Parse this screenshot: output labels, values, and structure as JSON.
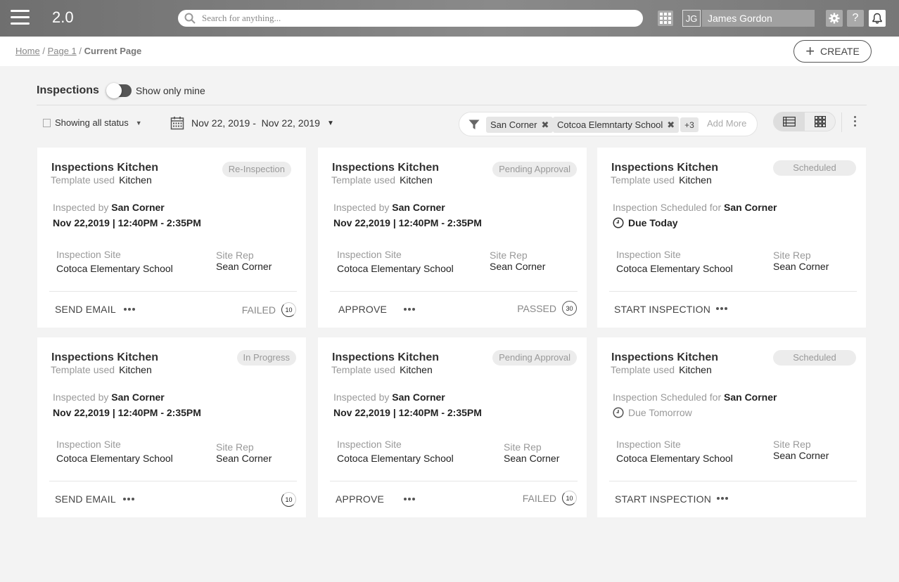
{
  "app": {
    "version": "2.0"
  },
  "search": {
    "placeholder": "Search for anything..."
  },
  "user": {
    "initials": "JG",
    "name": "James Gordon"
  },
  "topbar_icons": [
    "apps-grid-icon",
    "gear-icon",
    "help-icon",
    "bell-icon"
  ],
  "breadcrumb": {
    "home": "Home",
    "page1": "Page 1",
    "current": "Current Page",
    "sep": "/"
  },
  "create_label": "CREATE",
  "page_title": "Inspections",
  "toggle_label": "Show only mine",
  "status_filter": "Showing all status",
  "date_range": {
    "from": "Nov 22, 2019",
    "to": "Nov 22, 2019",
    "sep": "-"
  },
  "filters": {
    "chips": [
      "San Corner",
      "Cotcoa Elemntarty School"
    ],
    "more": "+3",
    "add_more": "Add More"
  },
  "cards": [
    {
      "title": "Inspections Kitchen",
      "template_label": "Template used",
      "template": "Kitchen",
      "status": "Re-Inspection",
      "by_label": "Inspected by",
      "by": "San Corner",
      "when": "Nov 22,2019 | 12:40PM - 2:35PM",
      "site_label": "Inspection Site",
      "site": "Cotoca Elementary School",
      "rep_label": "Site Rep",
      "rep": "Sean Corner",
      "action": "SEND EMAIL",
      "result": "FAILED",
      "score": "10"
    },
    {
      "title": "Inspections Kitchen",
      "template_label": "Template used",
      "template": "Kitchen",
      "status": "Pending Approval",
      "by_label": "Inspected by",
      "by": "San Corner",
      "when": "Nov 22,2019 | 12:40PM - 2:35PM",
      "site_label": "Inspection Site",
      "site": "Cotoca Elementary School",
      "rep_label": "Site Rep",
      "rep": "Sean Corner",
      "action": "APPROVE",
      "result": "PASSED",
      "score": "30"
    },
    {
      "title": "Inspections Kitchen",
      "template_label": "Template used",
      "template": "Kitchen",
      "status": "Scheduled",
      "by_label": "Inspection Scheduled for",
      "by": "San Corner",
      "when": "Due Today",
      "site_label": "Inspection Site",
      "site": "Cotoca Elementary School",
      "rep_label": "Site Rep",
      "rep": "Sean Corner",
      "action": "START INSPECTION"
    },
    {
      "title": "Inspections Kitchen",
      "template_label": "Template used",
      "template": "Kitchen",
      "status": "In Progress",
      "by_label": "Inspected by",
      "by": "San Corner",
      "when": "Nov 22,2019 | 12:40PM - 2:35PM",
      "site_label": "Inspection Site",
      "site": "Cotoca Elementary School",
      "rep_label": "Site Rep",
      "rep": "Sean Corner",
      "action": "SEND EMAIL",
      "score": "10"
    },
    {
      "title": "Inspections Kitchen",
      "template_label": "Template used",
      "template": "Kitchen",
      "status": "Pending Approval",
      "by_label": "Inspected by",
      "by": "San Corner",
      "when": "Nov 22,2019 | 12:40PM - 2:35PM",
      "site_label": "Inspection Site",
      "site": "Cotoca Elementary School",
      "rep_label": "Site Rep",
      "rep": "Sean Corner",
      "action": "APPROVE",
      "result": "FAILED",
      "score": "10"
    },
    {
      "title": "Inspections Kitchen",
      "template_label": "Template used",
      "template": "Kitchen",
      "status": "Scheduled",
      "by_label": "Inspection Scheduled for",
      "by": "San Corner",
      "when": "Due Tomorrow",
      "site_label": "Inspection Site",
      "site": "Cotoca Elementary School",
      "rep_label": "Site Rep",
      "rep": "Sean Corner",
      "action": "START INSPECTION"
    }
  ]
}
